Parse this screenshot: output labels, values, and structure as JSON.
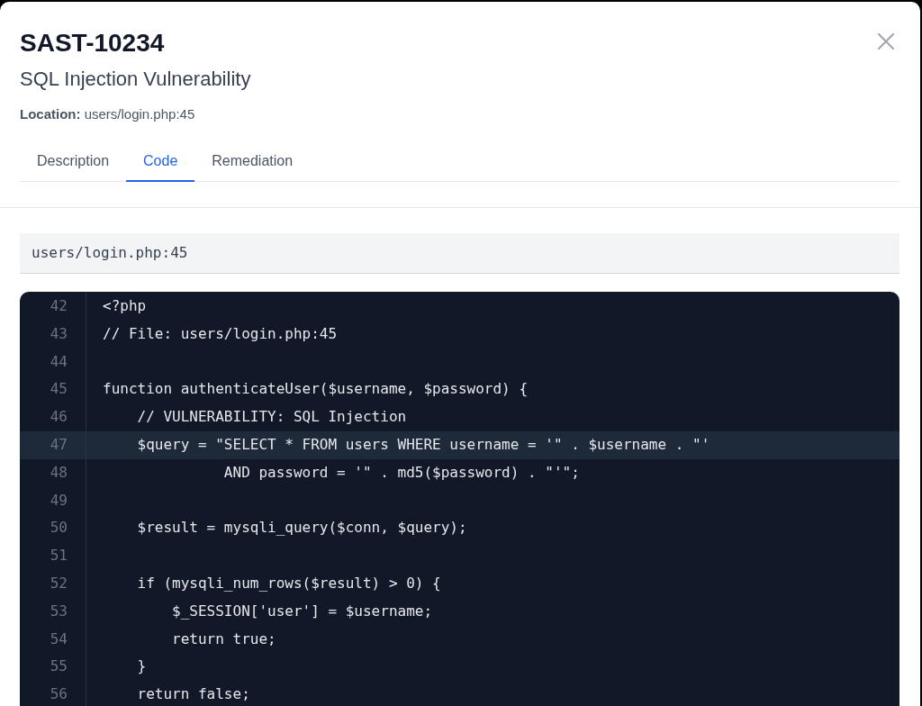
{
  "dialog": {
    "title": "SAST-10234",
    "subtitle": "SQL Injection Vulnerability",
    "location": "**Location:** users/login.php:45"
  },
  "tabs": [
    {
      "label": "Description",
      "selected": false
    },
    {
      "label": "Code",
      "selected": true
    },
    {
      "label": "Remediation",
      "selected": false
    }
  ],
  "code_panel": {
    "file_path": "users/login.php:45",
    "lines": [
      {
        "number": "42",
        "text": "<?php",
        "highlighted": false
      },
      {
        "number": "43",
        "text": "// File: users/login.php:45",
        "highlighted": false
      },
      {
        "number": "44",
        "highlighted": false
      },
      {
        "number": "45",
        "text": "function authenticateUser($username, $password) {",
        "highlighted": false
      },
      {
        "number": "46",
        "text": "    // VULNERABILITY: SQL Injection",
        "highlighted": false
      },
      {
        "number": "47",
        "text": "    $query = \"SELECT * FROM users WHERE username = '\" . $username . \"'",
        "highlighted": true
      },
      {
        "number": "48",
        "text": "              AND password = '\" . md5($password) . \"'\";",
        "highlighted": false
      },
      {
        "number": "49",
        "highlighted": false
      },
      {
        "number": "50",
        "text": "    $result = mysqli_query($conn, $query);",
        "highlighted": false
      },
      {
        "number": "51",
        "highlighted": false
      },
      {
        "number": "52",
        "text": "    if (mysqli_num_rows($result) > 0) {",
        "highlighted": false
      },
      {
        "number": "53",
        "text": "        $_SESSION['user'] = $username;",
        "highlighted": false
      },
      {
        "number": "54",
        "text": "        return true;",
        "highlighted": false
      },
      {
        "number": "55",
        "text": "    }",
        "highlighted": false
      },
      {
        "number": "56",
        "text": "    return false;",
        "highlighted": false
      }
    ]
  }
}
